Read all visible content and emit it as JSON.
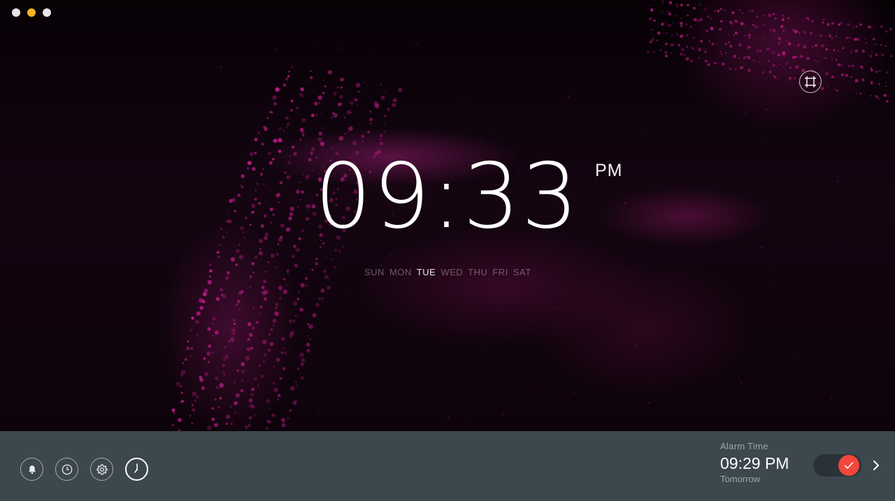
{
  "window": {
    "controls": [
      {
        "name": "close",
        "color": "#e6e6e6"
      },
      {
        "name": "minimize",
        "color": "#f5b623"
      },
      {
        "name": "zoom",
        "color": "#e6e6e6"
      }
    ]
  },
  "clock": {
    "time": "09:33",
    "meridiem": "PM",
    "weekdays": [
      "SUN",
      "MON",
      "TUE",
      "WED",
      "THU",
      "FRI",
      "SAT"
    ],
    "active_weekday": "TUE"
  },
  "toolbar": {
    "buttons": [
      {
        "icon": "bell-icon",
        "active": false
      },
      {
        "icon": "history-clock-icon",
        "active": false
      },
      {
        "icon": "gear-icon",
        "active": false
      },
      {
        "icon": "analog-clock-icon",
        "active": true
      }
    ]
  },
  "alarm": {
    "label": "Alarm Time",
    "time": "09:29 PM",
    "day": "Tomorrow",
    "enabled": true,
    "toggle_color": "#f2473a"
  },
  "colors": {
    "bottom_bar": "#3d474e",
    "accent_particles": "#d21e96"
  }
}
